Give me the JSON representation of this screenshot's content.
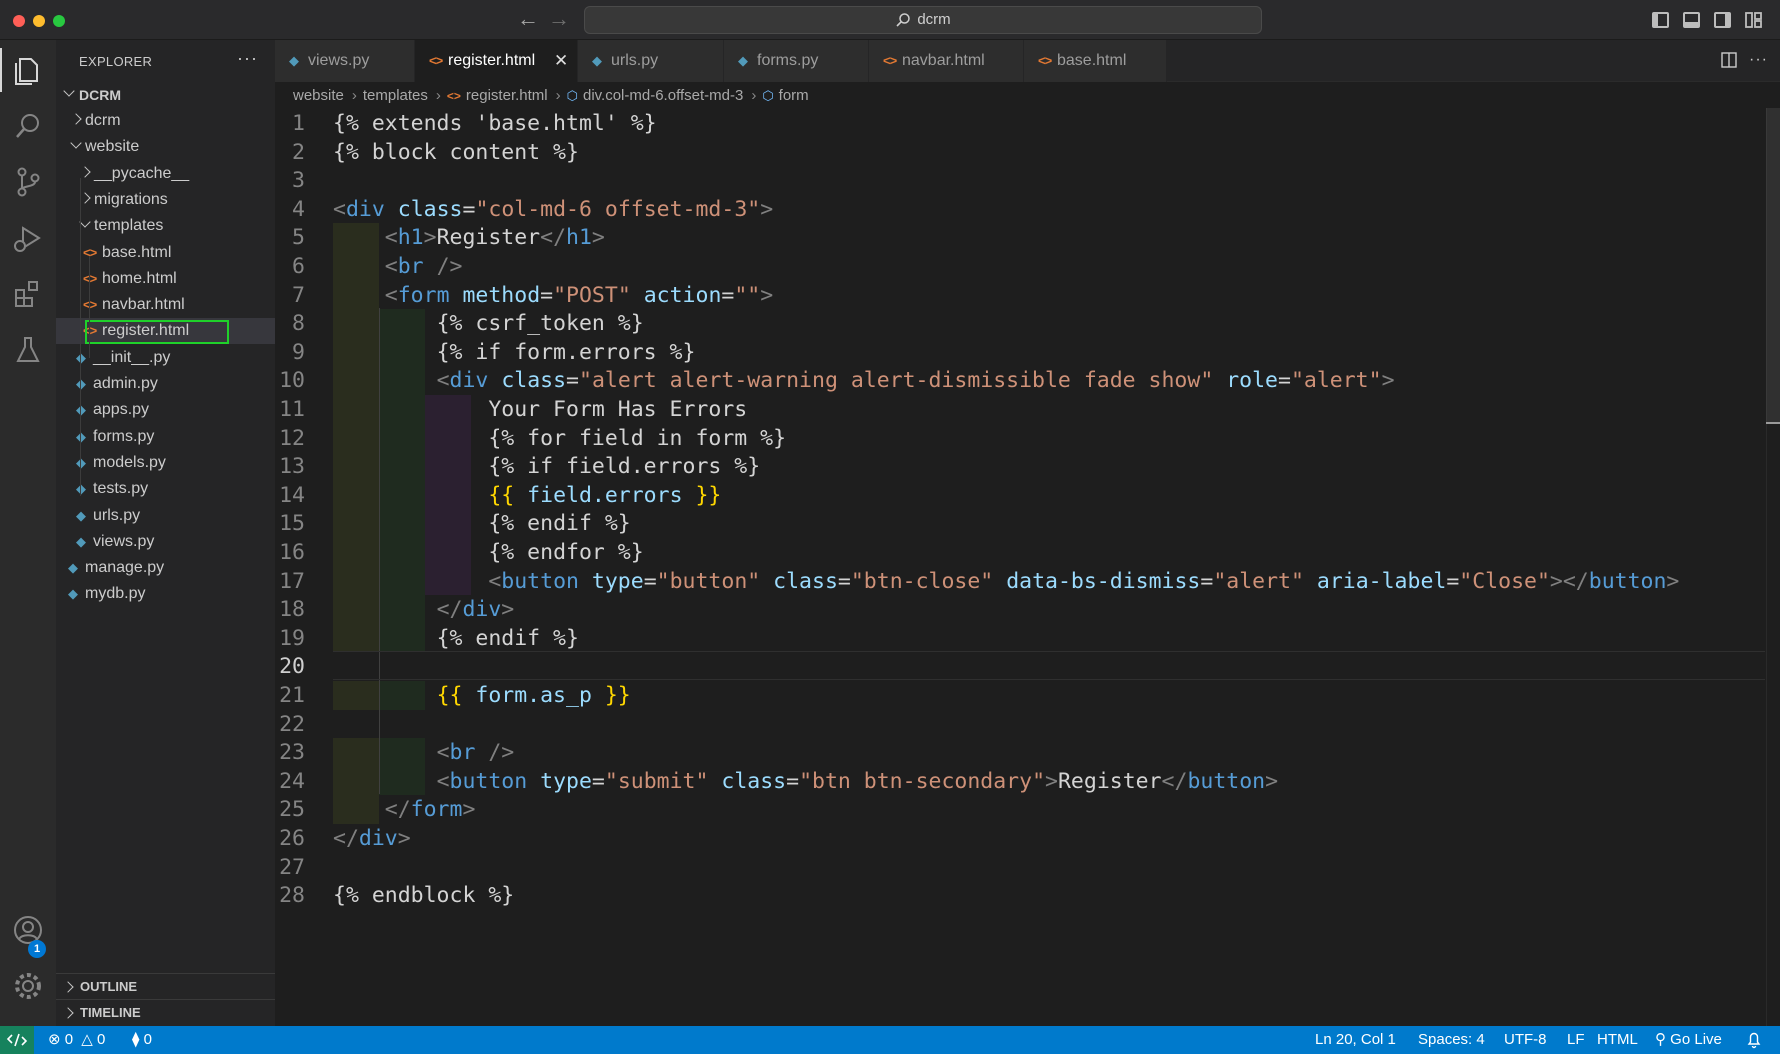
{
  "window": {
    "title": "dcrm"
  },
  "explorer": {
    "title": "EXPLORER",
    "more": "···",
    "root": "DCRM",
    "tree": [
      {
        "label": "dcrm",
        "kind": "folder",
        "expanded": false,
        "depth": 1
      },
      {
        "label": "website",
        "kind": "folder",
        "expanded": true,
        "depth": 1
      },
      {
        "label": "__pycache__",
        "kind": "folder",
        "expanded": false,
        "depth": 2
      },
      {
        "label": "migrations",
        "kind": "folder",
        "expanded": false,
        "depth": 2
      },
      {
        "label": "templates",
        "kind": "folder",
        "expanded": true,
        "depth": 2
      },
      {
        "label": "base.html",
        "kind": "html",
        "depth": 3
      },
      {
        "label": "home.html",
        "kind": "html",
        "depth": 3
      },
      {
        "label": "navbar.html",
        "kind": "html",
        "depth": 3
      },
      {
        "label": "register.html",
        "kind": "html",
        "depth": 3,
        "selected": true
      },
      {
        "label": "__init__.py",
        "kind": "py",
        "depth": 2
      },
      {
        "label": "admin.py",
        "kind": "py",
        "depth": 2
      },
      {
        "label": "apps.py",
        "kind": "py",
        "depth": 2
      },
      {
        "label": "forms.py",
        "kind": "py",
        "depth": 2
      },
      {
        "label": "models.py",
        "kind": "py",
        "depth": 2
      },
      {
        "label": "tests.py",
        "kind": "py",
        "depth": 2
      },
      {
        "label": "urls.py",
        "kind": "py",
        "depth": 2
      },
      {
        "label": "views.py",
        "kind": "py",
        "depth": 2
      },
      {
        "label": "manage.py",
        "kind": "py",
        "depth": 1
      },
      {
        "label": "mydb.py",
        "kind": "py",
        "depth": 1
      }
    ],
    "outline": "OUTLINE",
    "timeline": "TIMELINE"
  },
  "tabs": [
    {
      "label": "views.py",
      "kind": "py"
    },
    {
      "label": "register.html",
      "kind": "html",
      "active": true
    },
    {
      "label": "urls.py",
      "kind": "py"
    },
    {
      "label": "forms.py",
      "kind": "py"
    },
    {
      "label": "navbar.html",
      "kind": "html"
    },
    {
      "label": "base.html",
      "kind": "html"
    }
  ],
  "breadcrumbs": [
    "website",
    "templates",
    "register.html",
    "div.col-md-6.offset-md-3",
    "form"
  ],
  "editor": {
    "current_line": 20,
    "lines": [
      "{% extends 'base.html' %}",
      "{% block content %}",
      "",
      "<div class=\"col-md-6 offset-md-3\">",
      "    <h1>Register</h1>",
      "    <br />",
      "    <form method=\"POST\" action=\"\">",
      "        {% csrf_token %}",
      "        {% if form.errors %}",
      "        <div class=\"alert alert-warning alert-dismissible fade show\" role=\"alert\">",
      "            Your Form Has Errors",
      "            {% for field in form %}",
      "            {% if field.errors %}",
      "            {{ field.errors }}",
      "            {% endif %}",
      "            {% endfor %}",
      "            <button type=\"button\" class=\"btn-close\" data-bs-dismiss=\"alert\" aria-label=\"Close\"></button>",
      "        </div>",
      "        {% endif %}",
      "",
      "        {{ form.as_p }}",
      "",
      "        <br />",
      "        <button type=\"submit\" class=\"btn btn-secondary\">Register</button>",
      "    </form>",
      "</div>",
      "",
      "{% endblock %}"
    ]
  },
  "statusbar": {
    "errors": "0",
    "warnings": "0",
    "ports": "0",
    "position": "Ln 20, Col 1",
    "spaces": "Spaces: 4",
    "encoding": "UTF-8",
    "eol": "LF",
    "language": "HTML",
    "golive": "Go Live"
  },
  "accounts_badge": "1",
  "colors": {
    "accent": "#007acc",
    "selection_outline": "#1fd12a",
    "remote": "#16825d"
  }
}
